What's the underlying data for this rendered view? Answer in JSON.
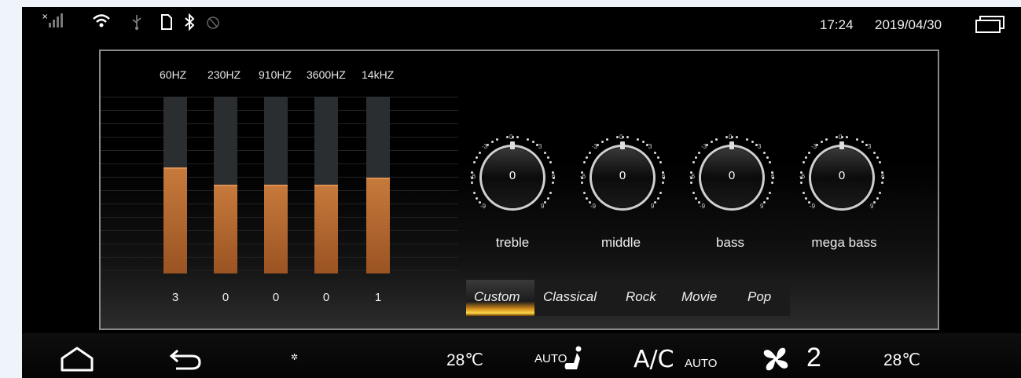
{
  "status_bar": {
    "icons": [
      "signal-off-icon",
      "wifi-icon",
      "usb-icon",
      "sd-card-icon",
      "bluetooth-icon",
      "gps-icon"
    ],
    "time": "17:24",
    "date": "2019/04/30",
    "window_icon": "recent-apps-icon"
  },
  "equalizer": {
    "bands": [
      {
        "freq": "60HZ",
        "value": "3",
        "level": 0.6
      },
      {
        "freq": "230HZ",
        "value": "0",
        "level": 0.5
      },
      {
        "freq": "910HZ",
        "value": "0",
        "level": 0.5
      },
      {
        "freq": "3600HZ",
        "value": "0",
        "level": 0.5
      },
      {
        "freq": "14kHZ",
        "value": "1",
        "level": 0.54
      }
    ]
  },
  "knobs": [
    {
      "label": "treble",
      "value": "0"
    },
    {
      "label": "middle",
      "value": "0"
    },
    {
      "label": "bass",
      "value": "0"
    },
    {
      "label": "mega bass",
      "value": "0"
    }
  ],
  "knob_scale": {
    "top": "0",
    "l3": "-3",
    "r3": "3",
    "l6": "-6",
    "r6": "6",
    "l9": "-9",
    "r9": "9"
  },
  "presets": {
    "selected": "Custom",
    "items": [
      "Custom",
      "Classical",
      "Rock",
      "Movie",
      "Pop"
    ]
  },
  "bottom_bar": {
    "home_icon": "home-icon",
    "back_icon": "back-icon",
    "night_icon": "night-mode-icon",
    "temp_left": "28℃",
    "seat_auto": "AUTO",
    "ac_label": "A/C",
    "ac_mode": "AUTO",
    "fan_speed": "2",
    "temp_right": "28℃"
  }
}
